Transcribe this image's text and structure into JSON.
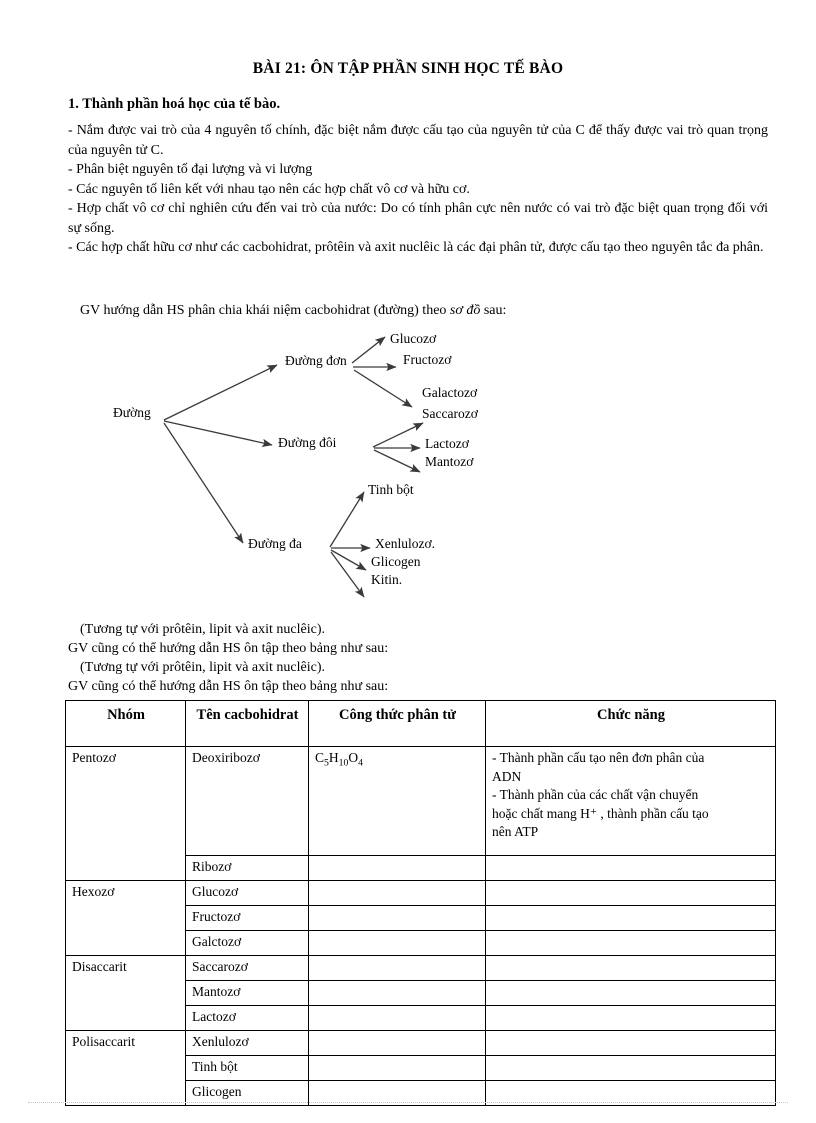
{
  "document": {
    "title": "BÀI 21: ÔN TẬP PHẦN SINH HỌC TẾ BÀO",
    "section_heading": "1. Thành phần hoá học của tế bào.",
    "paragraphs": [
      "- Nắm được vai trò của 4 nguyên tố chính, đặc biệt nắm được cấu tạo của nguyên tử của C để thấy được vai trò quan trọng của nguyên tử C.",
      "- Phân biệt nguyên tố đại lượng và vi lượng",
      "- Các nguyên tố liên kết với nhau tạo nên các hợp chất vô cơ và hữu cơ.",
      "- Hợp chất vô cơ chỉ nghiên cứu đến vai trò của nước: Do có tính phân cực nên nước có vai trò đặc biệt quan trọng đối với sự sống.",
      "- Các hợp chất hữu cơ như các cacbohidrat, prôtêin và axit nuclêic là các đại phân tử, được cấu tạo theo nguyên tắc đa phân."
    ],
    "intro_line": {
      "before": "GV hướng dẫn HS phân chia khái niệm cacbohidrat (đường) theo ",
      "italic": "sơ đồ",
      "after": " sau:"
    },
    "tail_lines": [
      "(Tương tự với  prôtêin, lipit và axit nuclêic).",
      "GV cũng có thể hướng dẫn HS ôn tập theo bảng như sau:",
      "(Tương tự với  prôtêin, lipit và axit nuclêic).",
      "GV cũng có thể hướng dẫn HS ôn tập theo bảng như sau:"
    ]
  },
  "diagram": {
    "root": "Đường",
    "branches": [
      {
        "name": "Đường đơn",
        "children": [
          "Glucozơ",
          "Fructozơ",
          "Galactozơ"
        ]
      },
      {
        "name": "Đường đôi",
        "children": [
          "Saccarozơ",
          "Lactozơ",
          "Mantozơ"
        ]
      },
      {
        "name": "Đường đa",
        "children": [
          "Tinh bột",
          "Xenlulozơ.",
          "Glicogen",
          "Kitin."
        ]
      }
    ]
  },
  "table": {
    "headers": [
      "Nhóm",
      "Tên cacbohidrat",
      "Công thức phân tử",
      "Chức năng"
    ],
    "groups": [
      {
        "name": "Pentozơ",
        "rows": [
          {
            "carbohydrate": "Deoxiribozơ",
            "formula_parts": [
              {
                "t": "C",
                "k": "n"
              },
              {
                "t": "5",
                "k": "sub"
              },
              {
                "t": "H",
                "k": "n"
              },
              {
                "t": "10",
                "k": "sub"
              },
              {
                "t": "O",
                "k": "n"
              },
              {
                "t": "4",
                "k": "sub"
              }
            ],
            "function_lines": [
              "- Thành phần cấu tạo nên đơn phân của",
              "ADN",
              "- Thành phần của các chất vận chuyển",
              "hoặc chất mang H⁺ , thành phần cấu tạo",
              "nên ATP"
            ],
            "tall": true,
            "indent": false
          },
          {
            "carbohydrate": "Ribozơ",
            "formula_parts": [],
            "function_lines": [],
            "tall": false,
            "indent": false
          }
        ]
      },
      {
        "name": "Hexozơ",
        "rows": [
          {
            "carbohydrate": "Glucozơ",
            "formula_parts": [],
            "function_lines": [],
            "tall": false,
            "indent": false
          },
          {
            "carbohydrate": "Fructozơ",
            "formula_parts": [],
            "function_lines": [],
            "tall": false,
            "indent": false
          },
          {
            "carbohydrate": "Galctozơ",
            "formula_parts": [],
            "function_lines": [],
            "tall": false,
            "indent": false
          }
        ]
      },
      {
        "name": "Disaccarit",
        "rows": [
          {
            "carbohydrate": "Saccarozơ",
            "formula_parts": [],
            "function_lines": [],
            "tall": false,
            "indent": true
          },
          {
            "carbohydrate": "Mantozơ",
            "formula_parts": [],
            "function_lines": [],
            "tall": false,
            "indent": false
          },
          {
            "carbohydrate": "Lactozơ",
            "formula_parts": [],
            "function_lines": [],
            "tall": false,
            "indent": false
          }
        ]
      },
      {
        "name": "Polisaccarit",
        "rows": [
          {
            "carbohydrate": "Xenlulozơ",
            "formula_parts": [],
            "function_lines": [],
            "tall": false,
            "indent": false
          },
          {
            "carbohydrate": "Tinh bột",
            "formula_parts": [],
            "function_lines": [],
            "tall": false,
            "indent": false
          },
          {
            "carbohydrate": "Glicogen",
            "formula_parts": [],
            "function_lines": [],
            "tall": false,
            "indent": false
          }
        ]
      }
    ]
  },
  "colors": {
    "text": "#000000",
    "rule": "#000000",
    "footer_rule": "#c8c8c8"
  }
}
